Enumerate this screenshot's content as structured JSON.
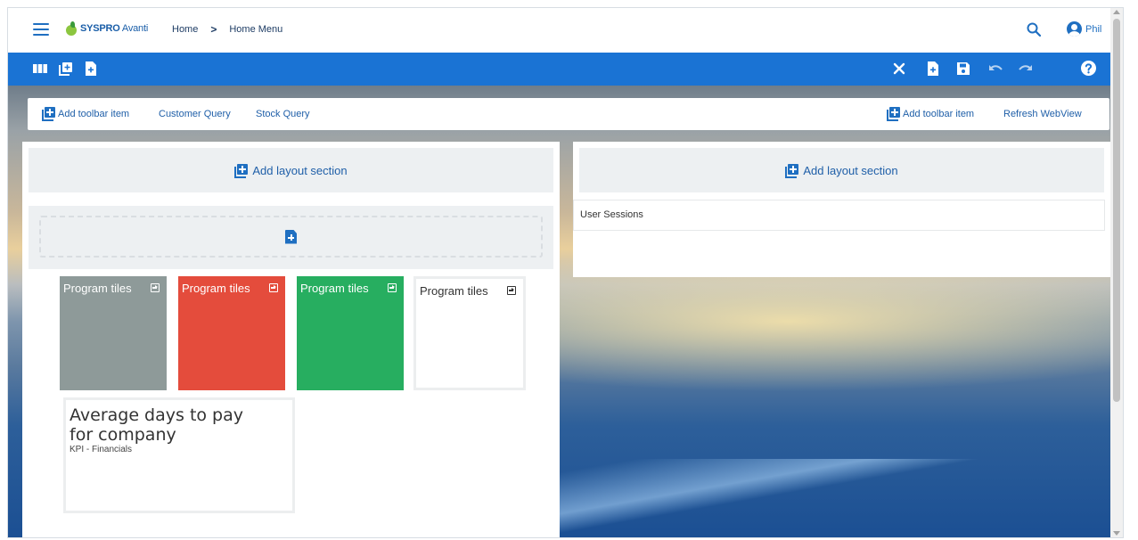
{
  "header": {
    "logo_brand": "SYSPRO",
    "logo_product": "Avanti",
    "breadcrumb": [
      "Home",
      "Home Menu"
    ],
    "breadcrumb_separator": ">",
    "user_name": "Phil"
  },
  "toolbar": {
    "left_icons": [
      "columns-icon",
      "add-panel-icon",
      "add-document-icon"
    ],
    "right_icons": [
      "close-icon",
      "add-document-icon",
      "save-icon",
      "undo-icon",
      "redo-icon",
      "help-icon"
    ]
  },
  "subbar": {
    "left_items": [
      "Add toolbar item",
      "Customer Query",
      "Stock Query"
    ],
    "right_items": [
      "Add toolbar item",
      "Refresh WebView"
    ]
  },
  "left_panel": {
    "add_section_label": "Add layout section",
    "tiles": [
      {
        "label": "Program tiles",
        "color": "#8e9a99"
      },
      {
        "label": "Program tiles",
        "color": "#e44c3c"
      },
      {
        "label": "Program tiles",
        "color": "#27ae60"
      },
      {
        "label": "Program tiles",
        "color": "#ffffff"
      }
    ],
    "kpi": {
      "title": "Average days to pay for company",
      "subtitle": "KPI - Financials"
    }
  },
  "right_panel": {
    "add_section_label": "Add layout section",
    "widget_title": "User Sessions"
  },
  "colors": {
    "accent": "#1a73d4",
    "link": "#1f5fa8"
  }
}
